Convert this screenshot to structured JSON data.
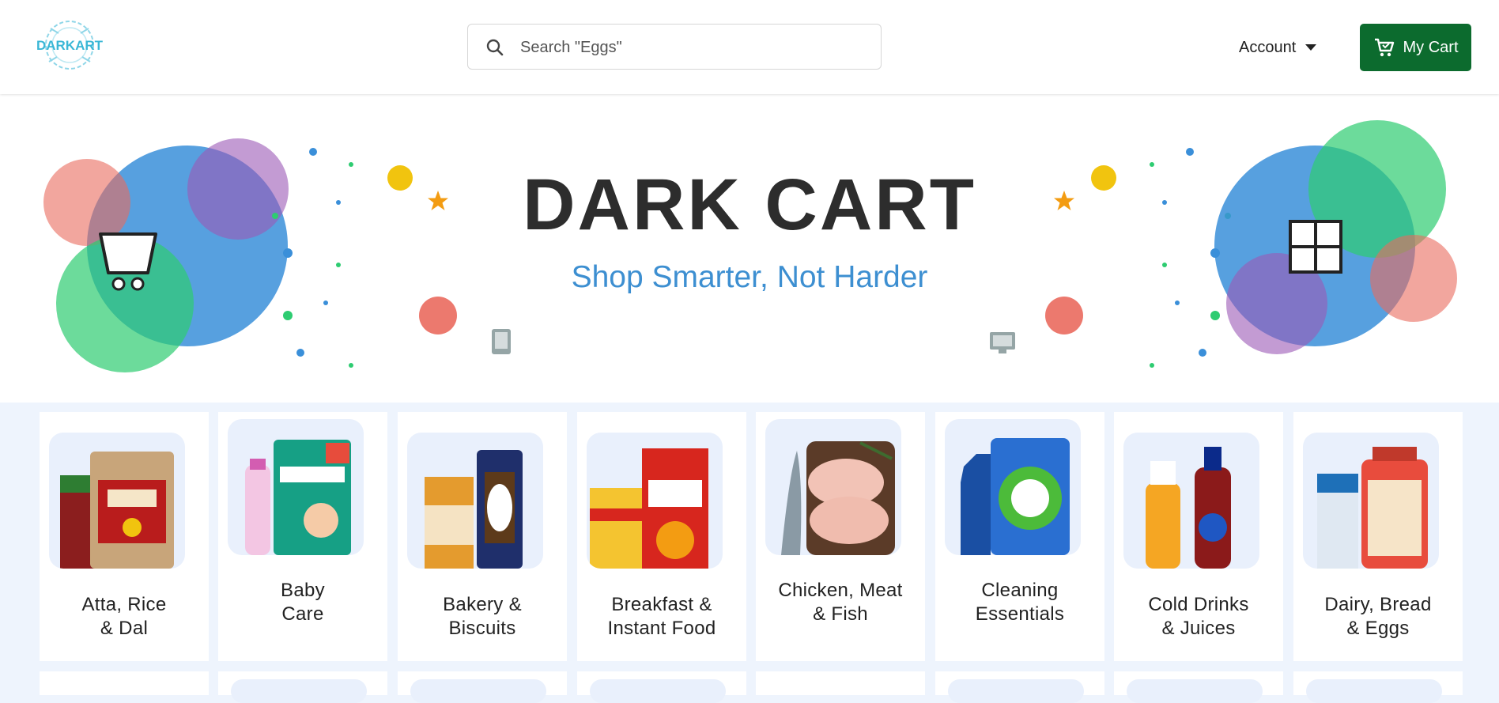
{
  "header": {
    "logo_text": "DARKART",
    "search": {
      "placeholder": "Search \"Eggs\""
    },
    "account_label": "Account",
    "cart_label": "My Cart"
  },
  "banner": {
    "title": "DARK CART",
    "subtitle": "Shop Smarter, Not Harder"
  },
  "categories": [
    {
      "label": "Atta, Rice\n& Dal",
      "icon": "grains-bags"
    },
    {
      "label": "Baby\nCare",
      "icon": "diapers-pack"
    },
    {
      "label": "Bakery &\nBiscuits",
      "icon": "biscuits-pack"
    },
    {
      "label": "Breakfast &\nInstant Food",
      "icon": "cereal-box"
    },
    {
      "label": "Chicken, Meat\n& Fish",
      "icon": "chicken-fish"
    },
    {
      "label": "Cleaning\nEssentials",
      "icon": "detergent-pack"
    },
    {
      "label": "Cold Drinks\n& Juices",
      "icon": "drink-bottles"
    },
    {
      "label": "Dairy, Bread\n& Eggs",
      "icon": "milk-bread"
    }
  ],
  "colors": {
    "cart_button": "#0c6b2e",
    "subtitle": "#3d8fd1",
    "page_bg": "#eef4fd"
  }
}
